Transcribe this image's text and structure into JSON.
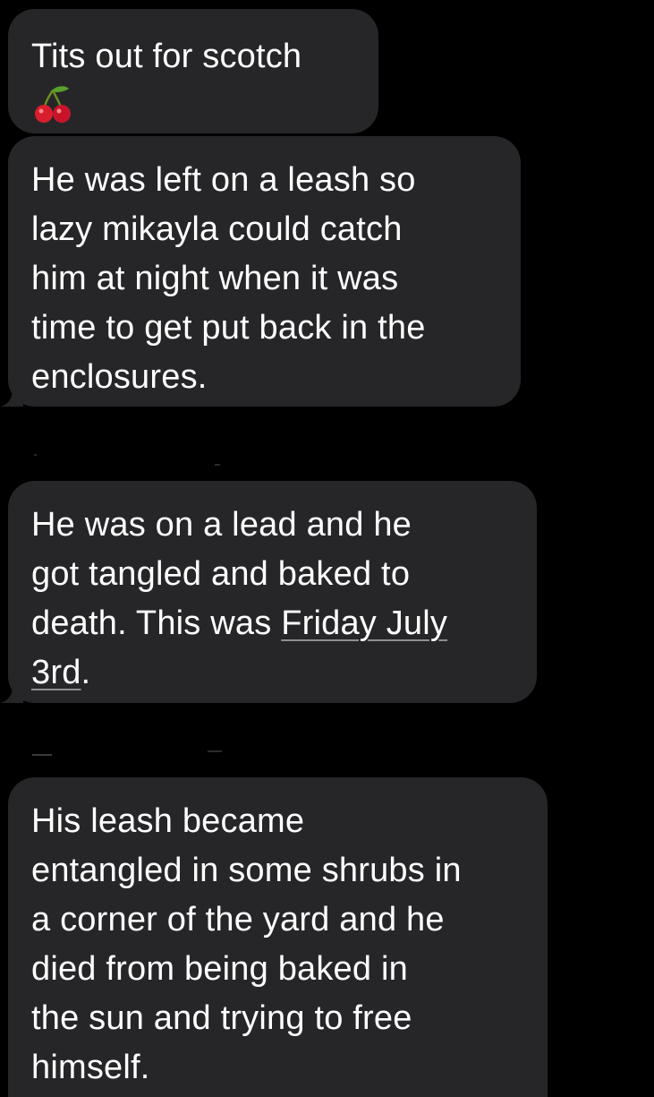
{
  "messages": [
    {
      "lines": [
        "Tits out for scotch"
      ],
      "emoji": "cherries"
    },
    {
      "lines": [
        "He was left on a leash so",
        "lazy mikayla could catch",
        "him at night when it was",
        "time to get put back in the",
        "enclosures."
      ]
    },
    {
      "line1": "He was on a lead and he",
      "line2": "got tangled and baked to",
      "line3_prefix": "death. This was ",
      "date_link_part1": "Friday July",
      "date_link_part2": "3rd",
      "line4_suffix": "."
    },
    {
      "lines": [
        "His leash became",
        "entangled in some shrubs in",
        "a corner of the yard and he",
        "died from being baked in",
        "the sun and trying to free",
        "himself."
      ]
    }
  ],
  "colors": {
    "background": "#000000",
    "bubble": "#262629",
    "text": "#ffffff"
  }
}
